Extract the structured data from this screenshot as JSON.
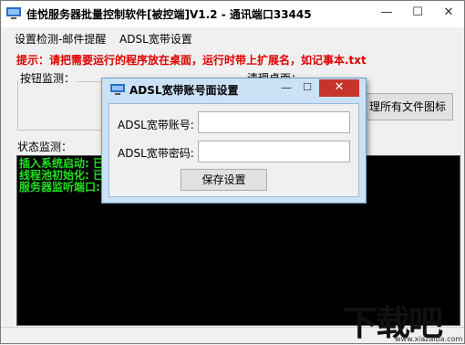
{
  "window": {
    "title": "佳悦服务器批量控制软件[被控端]V1.2 - 通讯端口33445",
    "minimize_glyph": "—",
    "maximize_glyph": "☐",
    "close_glyph": "✕"
  },
  "menu": {
    "items": [
      {
        "label": "设置检测-邮件提醒"
      },
      {
        "label": "ADSL宽带设置"
      }
    ]
  },
  "hint": "提示：请把需要运行的程序放在桌面，运行时带上扩展名，如记事本.txt",
  "groups": {
    "buttons_monitor": "按钮监测：",
    "clean_desktop": "清理桌面：",
    "status_monitor": "状态监测："
  },
  "clean_button": "理所有文件图标",
  "console": {
    "lines": [
      "插入系统启动: 已",
      "线程池初始化: 已",
      "服务器监听端口:"
    ]
  },
  "dialog": {
    "title": "ADSL宽带账号面设置",
    "min_glyph": "—",
    "max_glyph": "☐",
    "close_glyph": "✕",
    "account_label": "ADSL宽带账号:",
    "account_value": "",
    "password_label": "ADSL宽带密码:",
    "password_value": "",
    "save_label": "保存设置"
  },
  "watermark": {
    "logo": "下载吧",
    "url": "www.xiazaiba.com"
  },
  "colors": {
    "hint_red": "#e00000",
    "console_green": "#21e021",
    "dialog_frame": "#cbe1f5",
    "close_red": "#c7342c"
  }
}
